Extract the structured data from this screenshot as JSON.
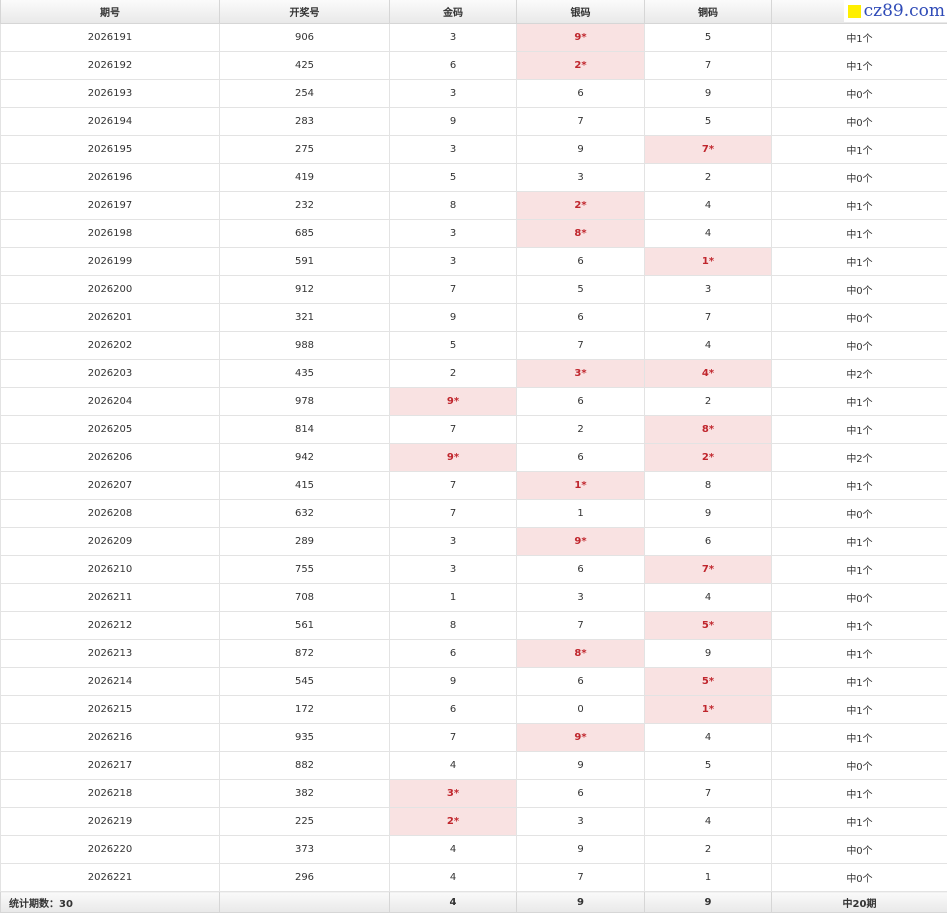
{
  "watermark": {
    "text": "cz89.com",
    "square_color": "#ffef00",
    "text_color": "#2f4bb7"
  },
  "colors": {
    "hit_bg": "#f9e2e2",
    "hit_text": "#c0262d",
    "header_bg": "#eeeeee"
  },
  "table": {
    "headers": [
      "期号",
      "开奖号",
      "金码",
      "银码",
      "铜码",
      ""
    ],
    "rows": [
      [
        "2026191",
        "906",
        "3",
        "9*",
        "5",
        "中1个"
      ],
      [
        "2026192",
        "425",
        "6",
        "2*",
        "7",
        "中1个"
      ],
      [
        "2026193",
        "254",
        "3",
        "6",
        "9",
        "中0个"
      ],
      [
        "2026194",
        "283",
        "9",
        "7",
        "5",
        "中0个"
      ],
      [
        "2026195",
        "275",
        "3",
        "9",
        "7*",
        "中1个"
      ],
      [
        "2026196",
        "419",
        "5",
        "3",
        "2",
        "中0个"
      ],
      [
        "2026197",
        "232",
        "8",
        "2*",
        "4",
        "中1个"
      ],
      [
        "2026198",
        "685",
        "3",
        "8*",
        "4",
        "中1个"
      ],
      [
        "2026199",
        "591",
        "3",
        "6",
        "1*",
        "中1个"
      ],
      [
        "2026200",
        "912",
        "7",
        "5",
        "3",
        "中0个"
      ],
      [
        "2026201",
        "321",
        "9",
        "6",
        "7",
        "中0个"
      ],
      [
        "2026202",
        "988",
        "5",
        "7",
        "4",
        "中0个"
      ],
      [
        "2026203",
        "435",
        "2",
        "3*",
        "4*",
        "中2个"
      ],
      [
        "2026204",
        "978",
        "9*",
        "6",
        "2",
        "中1个"
      ],
      [
        "2026205",
        "814",
        "7",
        "2",
        "8*",
        "中1个"
      ],
      [
        "2026206",
        "942",
        "9*",
        "6",
        "2*",
        "中2个"
      ],
      [
        "2026207",
        "415",
        "7",
        "1*",
        "8",
        "中1个"
      ],
      [
        "2026208",
        "632",
        "7",
        "1",
        "9",
        "中0个"
      ],
      [
        "2026209",
        "289",
        "3",
        "9*",
        "6",
        "中1个"
      ],
      [
        "2026210",
        "755",
        "3",
        "6",
        "7*",
        "中1个"
      ],
      [
        "2026211",
        "708",
        "1",
        "3",
        "4",
        "中0个"
      ],
      [
        "2026212",
        "561",
        "8",
        "7",
        "5*",
        "中1个"
      ],
      [
        "2026213",
        "872",
        "6",
        "8*",
        "9",
        "中1个"
      ],
      [
        "2026214",
        "545",
        "9",
        "6",
        "5*",
        "中1个"
      ],
      [
        "2026215",
        "172",
        "6",
        "0",
        "1*",
        "中1个"
      ],
      [
        "2026216",
        "935",
        "7",
        "9*",
        "4",
        "中1个"
      ],
      [
        "2026217",
        "882",
        "4",
        "9",
        "5",
        "中0个"
      ],
      [
        "2026218",
        "382",
        "3*",
        "6",
        "7",
        "中1个"
      ],
      [
        "2026219",
        "225",
        "2*",
        "3",
        "4",
        "中1个"
      ],
      [
        "2026220",
        "373",
        "4",
        "9",
        "2",
        "中0个"
      ],
      [
        "2026221",
        "296",
        "4",
        "7",
        "1",
        "中0个"
      ]
    ],
    "footer": [
      "统计期数：30",
      "",
      "4",
      "9",
      "9",
      "中20期"
    ]
  }
}
